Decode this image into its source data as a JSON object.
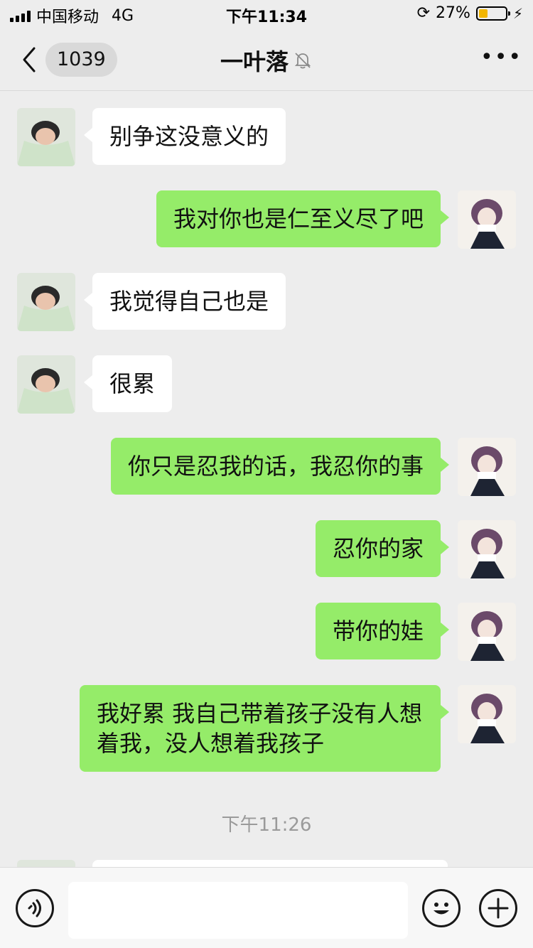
{
  "status_bar": {
    "carrier": "中国移动",
    "network": "4G",
    "time": "下午11:34",
    "battery_percent": "27%",
    "battery_level": 0.27,
    "battery_color": "#f2b600"
  },
  "header": {
    "back_icon": "chevron-left-icon",
    "unread_count": "1039",
    "title": "一叶落",
    "muted_icon": "bell-off-icon",
    "more_icon": "more-icon"
  },
  "messages": [
    {
      "side": "left",
      "text": "别争这没意义的"
    },
    {
      "side": "right",
      "text": "我对你也是仁至义尽了吧"
    },
    {
      "side": "left",
      "text": "我觉得自己也是"
    },
    {
      "side": "left",
      "text": "很累"
    },
    {
      "side": "right",
      "text": "你只是忍我的话，我忍你的事"
    },
    {
      "side": "right",
      "text": "忍你的家"
    },
    {
      "side": "right",
      "text": "带你的娃"
    },
    {
      "side": "right",
      "text": "我好累 我自己带着孩子没有人想着我，没人想着我孩子"
    }
  ],
  "time_separator": "下午11:26",
  "input_bar": {
    "voice_icon": "voice-icon",
    "emoji_icon": "emoji-icon",
    "plus_icon": "plus-icon",
    "text_value": ""
  },
  "colors": {
    "self_bubble": "#95ec69",
    "other_bubble": "#ffffff",
    "background": "#ededed"
  }
}
